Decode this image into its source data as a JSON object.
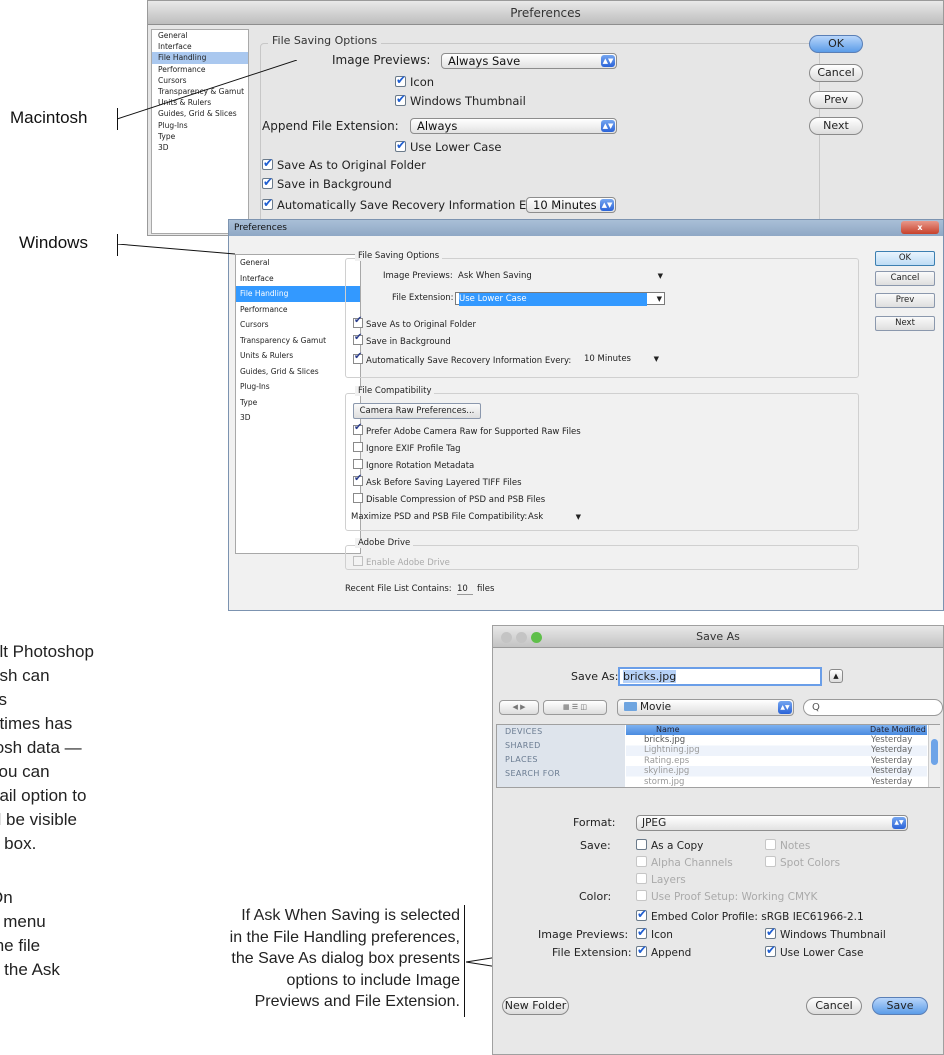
{
  "mac": {
    "title": "Preferences",
    "sidebar": [
      "General",
      "Interface",
      "File Handling",
      "Performance",
      "Cursors",
      "Transparency & Gamut",
      "Units & Rulers",
      "Guides, Grid & Slices",
      "Plug-Ins",
      "Type",
      "3D"
    ],
    "group_title": "File Saving Options",
    "image_previews_label": "Image Previews:",
    "image_previews_value": "Always Save",
    "icon_label": "Icon",
    "windows_thumbnail_label": "Windows Thumbnail",
    "append_ext_label": "Append File Extension:",
    "append_ext_value": "Always",
    "use_lower_case_label": "Use Lower Case",
    "save_original_folder": "Save As to Original Folder",
    "save_background": "Save in Background",
    "auto_save_label": "Automatically Save Recovery Information Every:",
    "auto_save_value": "10 Minutes",
    "buttons": {
      "ok": "OK",
      "cancel": "Cancel",
      "prev": "Prev",
      "next": "Next"
    }
  },
  "win": {
    "title": "Preferences",
    "close": "x",
    "sidebar": [
      "General",
      "Interface",
      "File Handling",
      "Performance",
      "Cursors",
      "Transparency & Gamut",
      "Units & Rulers",
      "Guides, Grid & Slices",
      "Plug-Ins",
      "Type",
      "3D"
    ],
    "saving_title": "File Saving Options",
    "image_previews_label": "Image Previews:",
    "image_previews_value": "Ask When Saving",
    "file_ext_label": "File Extension:",
    "file_ext_value": "Use Lower Case",
    "save_original_folder": "Save As to Original Folder",
    "save_background": "Save in Background",
    "auto_save_label": "Automatically Save Recovery Information Every:",
    "auto_save_value": "10 Minutes",
    "compat_title": "File Compatibility",
    "camera_raw_button": "Camera Raw Preferences...",
    "prefer_camera_raw": "Prefer Adobe Camera Raw for Supported Raw Files",
    "ignore_exif": "Ignore EXIF Profile Tag",
    "ignore_rotation": "Ignore Rotation Metadata",
    "ask_tiff": "Ask Before Saving Layered TIFF Files",
    "disable_compression": "Disable Compression of PSD and PSB Files",
    "maximize_label": "Maximize PSD and PSB File Compatibility:",
    "maximize_value": "Ask",
    "drive_title": "Adobe Drive",
    "enable_drive": "Enable Adobe Drive",
    "recent_label": "Recent File List Contains:",
    "recent_value": "10",
    "recent_unit": "files",
    "buttons": {
      "ok": "OK",
      "cancel": "Cancel",
      "prev": "Prev",
      "next": "Next"
    }
  },
  "saveas": {
    "title": "Save As",
    "save_as_label": "Save As:",
    "filename": "bricks.jpg",
    "folder": "Movie",
    "search_icon_glyph": "Q",
    "sidebar": [
      "DEVICES",
      "SHARED",
      "PLACES",
      "SEARCH FOR"
    ],
    "col_name": "Name",
    "col_date": "Date Modified",
    "files": [
      {
        "name": "bricks.jpg",
        "date": "Yesterday"
      },
      {
        "name": "Lightning.jpg",
        "date": "Yesterday"
      },
      {
        "name": "Rating.eps",
        "date": "Yesterday"
      },
      {
        "name": "skyline.jpg",
        "date": "Yesterday"
      },
      {
        "name": "storm.jpg",
        "date": "Yesterday"
      }
    ],
    "format_label": "Format:",
    "format_value": "JPEG",
    "save_label": "Save:",
    "as_a_copy": "As a Copy",
    "notes": "Notes",
    "alpha_channels": "Alpha Channels",
    "spot_colors": "Spot Colors",
    "layers": "Layers",
    "color_label": "Color:",
    "use_proof": "Use Proof Setup:  Working CMYK",
    "embed_profile": "Embed Color Profile:  sRGB IEC61966-2.1",
    "image_previews_label": "Image Previews:",
    "icon": "Icon",
    "windows_thumbnail": "Windows Thumbnail",
    "file_ext_label": "File Extension:",
    "append": "Append",
    "use_lower_case": "Use Lower Case",
    "new_folder": "New Folder",
    "cancel": "Cancel",
    "save": "Save"
  },
  "annotations": {
    "macintosh": "Macintosh",
    "windows": "Windows",
    "caption_lines": [
      "If Ask When Saving is selected",
      "in the File Handling preferences,",
      "the Save As dialog box presents",
      "options to include Image",
      "Previews and File Extension."
    ]
  },
  "body_text_lines": [
    "ult Photoshop",
    "osh can",
    "vs",
    "etimes has",
    "tosh data —",
    " you can",
    "nail option to",
    "ill be visible",
    "g box.",
    "",
    "On",
    "s menu",
    "the file",
    "If the Ask"
  ]
}
